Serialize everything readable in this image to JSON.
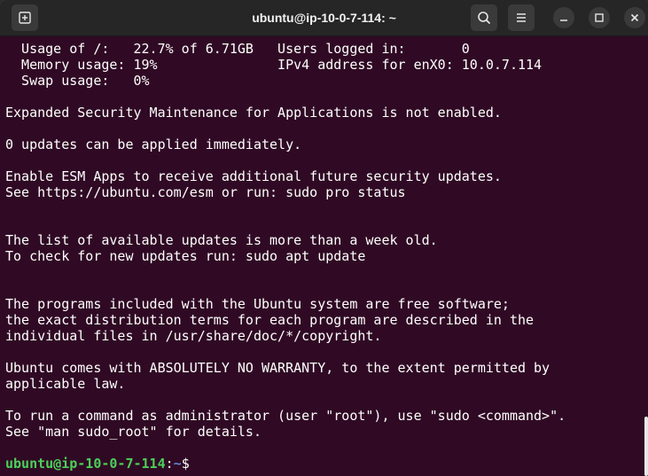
{
  "window": {
    "title": "ubuntu@ip-10-0-7-114: ~"
  },
  "toolbar": {
    "new_tab_icon": "new-tab-icon",
    "search_icon": "search-icon",
    "menu_icon": "hamburger-menu-icon",
    "minimize_icon": "minimize-icon",
    "maximize_icon": "maximize-icon",
    "close_icon": "close-icon"
  },
  "terminal": {
    "lines": [
      "  Usage of /:   22.7% of 6.71GB   Users logged in:       0",
      "  Memory usage: 19%               IPv4 address for enX0: 10.0.7.114",
      "  Swap usage:   0%",
      "",
      "Expanded Security Maintenance for Applications is not enabled.",
      "",
      "0 updates can be applied immediately.",
      "",
      "Enable ESM Apps to receive additional future security updates.",
      "See https://ubuntu.com/esm or run: sudo pro status",
      "",
      "",
      "The list of available updates is more than a week old.",
      "To check for new updates run: sudo apt update",
      "",
      "",
      "The programs included with the Ubuntu system are free software;",
      "the exact distribution terms for each program are described in the",
      "individual files in /usr/share/doc/*/copyright.",
      "",
      "Ubuntu comes with ABSOLUTELY NO WARRANTY, to the extent permitted by",
      "applicable law.",
      "",
      "To run a command as administrator (user \"root\"), use \"sudo <command>\".",
      "See \"man sudo_root\" for details.",
      ""
    ],
    "prompt": {
      "user_host": "ubuntu@ip-10-0-7-114",
      "separator": ":",
      "path": "~",
      "symbol": "$"
    }
  },
  "colors": {
    "terminal_bg": "#300a24",
    "titlebar_bg": "#262626",
    "prompt_user": "#4bd05a",
    "prompt_path": "#5f87d7",
    "text": "#ffffff"
  }
}
